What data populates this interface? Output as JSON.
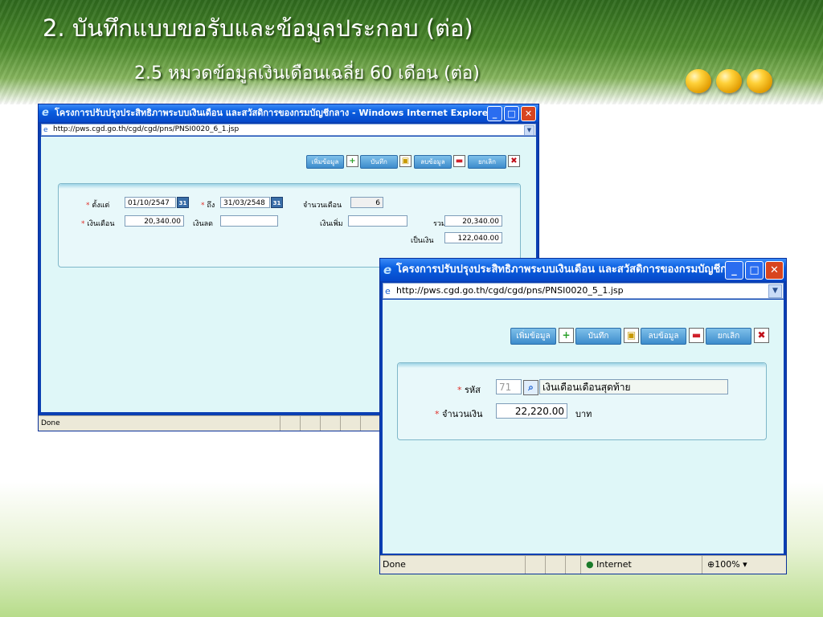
{
  "slide": {
    "title": "2. บันทึกแบบขอรับและข้อมูลประกอบ (ต่อ)",
    "subtitle": "2.5 หมวดข้อมูลเงินเดือนเฉลี่ย 60 เดือน (ต่อ)"
  },
  "window1": {
    "title": "โครงการปรับปรุงประสิทธิภาพระบบเงินเดือน และสวัสดิการของกรมบัญชีกลาง - Windows Internet Explorer",
    "url": "http://pws.cgd.go.th/cgd/cgd/pns/PNSI0020_6_1.jsp",
    "buttons": {
      "add": "เพิ่มข้อมูล",
      "save": "บันทึก",
      "delete": "ลบข้อมูล",
      "cancel": "ยกเลิก"
    },
    "form": {
      "from_label": "ตั้งแต่",
      "from_value": "01/10/2547",
      "to_label": "ถึง",
      "to_value": "31/03/2548",
      "months_label": "จำนวนเดือน",
      "months_value": "6",
      "salary_label": "เงินเดือน",
      "salary_value": "20,340.00",
      "deduct_label": "เงินลด",
      "deduct_value": "",
      "extra_label": "เงินเพิ่ม",
      "extra_value": "",
      "total_label": "รวม",
      "total_value": "20,340.00",
      "amount_label": "เป็นเงิน",
      "amount_value": "122,040.00"
    },
    "status": "Done",
    "calendar_label": "31"
  },
  "window2": {
    "title": "โครงการปรับปรุงประสิทธิภาพระบบเงินเดือน และสวัสดิการของกรมบัญชีก...",
    "url": "http://pws.cgd.go.th/cgd/cgd/pns/PNSI0020_5_1.jsp",
    "buttons": {
      "add": "เพิ่มข้อมูล",
      "save": "บันทึก",
      "delete": "ลบข้อมูล",
      "cancel": "ยกเลิก"
    },
    "form": {
      "code_label": "รหัส",
      "code_value": "71",
      "code_desc": "เงินเดือนเดือนสุดท้าย",
      "amount_label": "จำนวนเงิน",
      "amount_value": "22,220.00",
      "unit": "บาท"
    },
    "status": "Done",
    "zone": "Internet",
    "zoom": "100%"
  },
  "colors": {
    "window_frame": "#0a3fb3",
    "content_bg": "#dff7f8",
    "required": "#e0302a"
  }
}
